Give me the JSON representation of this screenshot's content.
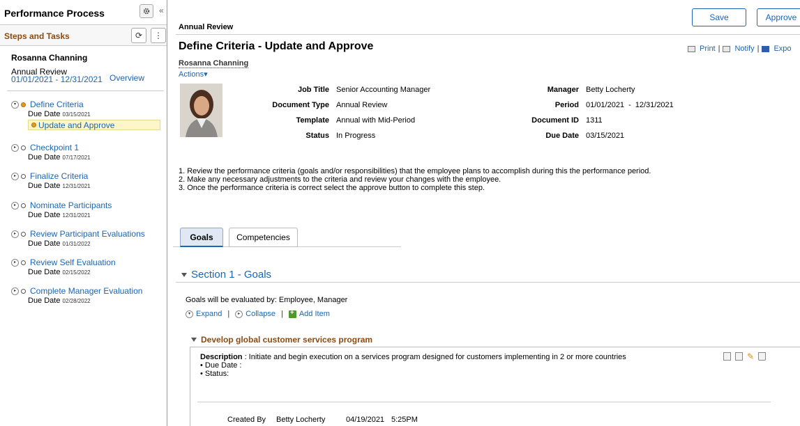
{
  "left": {
    "title": "Performance Process",
    "steps_header": "Steps and Tasks",
    "employee": "Rosanna Channing",
    "document_type": "Annual Review",
    "period_start": "01/01/2021",
    "period_sep": "-",
    "period_end": "12/31/2021",
    "overview": "Overview",
    "due_label": "Due Date",
    "steps": [
      {
        "label": "Define Criteria",
        "due": "03/15/2021",
        "status": "in-progress",
        "expanded": true,
        "subtask": "Update and Approve"
      },
      {
        "label": "Checkpoint 1",
        "due": "07/17/2021",
        "status": "not-started"
      },
      {
        "label": "Finalize Criteria",
        "due": "12/31/2021",
        "status": "not-started"
      },
      {
        "label": "Nominate Participants",
        "due": "12/31/2021",
        "status": "not-started"
      },
      {
        "label": "Review Participant Evaluations",
        "due": "01/31/2022",
        "status": "not-started"
      },
      {
        "label": "Review Self Evaluation",
        "due": "02/15/2022",
        "status": "not-started"
      },
      {
        "label": "Complete Manager Evaluation",
        "due": "02/28/2022",
        "status": "not-started"
      }
    ]
  },
  "toolbar": {
    "save": "Save",
    "approve": "Approve"
  },
  "main": {
    "breadcrumb": "Annual Review",
    "title": "Define Criteria - Update and Approve",
    "print": "Print",
    "notify": "Notify",
    "export": "Expo",
    "employee": "Rosanna Channing",
    "actions": "Actions",
    "details": {
      "job_title_label": "Job Title",
      "job_title": "Senior Accounting Manager",
      "doc_type_label": "Document Type",
      "doc_type": "Annual Review",
      "template_label": "Template",
      "template": "Annual with Mid-Period",
      "status_label": "Status",
      "status": "In Progress",
      "manager_label": "Manager",
      "manager": "Betty Locherty",
      "period_label": "Period",
      "period_start": "01/01/2021",
      "period_sep": "-",
      "period_end": "12/31/2021",
      "doc_id_label": "Document ID",
      "doc_id": "1311",
      "due_label": "Due Date",
      "due": "03/15/2021"
    },
    "instructions": [
      "1. Review the performance criteria (goals and/or responsibilities) that the employee plans to accomplish during this the performance period.",
      "2. Make any necessary adjustments to the criteria and review your changes with the employee.",
      "3. Once the performance criteria is correct select the approve button to complete this step."
    ],
    "tabs": [
      "Goals",
      "Competencies"
    ],
    "section_title": "Section 1 - Goals",
    "evaluated_by": "Goals will be evaluated by: Employee, Manager",
    "expand": "Expand",
    "collapse": "Collapse",
    "add_item": "Add Item",
    "item": {
      "title": "Develop global customer services program",
      "desc_label": "Description",
      "desc": " : Initiate and begin execution on a services program designed for customers implementing in 2 or more countries",
      "due_line": "• Due Date :",
      "status_line": "• Status:",
      "created_by_label": "Created By",
      "created_by": "Betty Locherty",
      "created_date": "04/19/2021",
      "created_time": "5:25PM"
    }
  },
  "colors": {
    "link": "#1a65b5",
    "section_brown": "#8a4b12",
    "highlight": "#fdf6c8",
    "in_progress": "#e39b1b"
  }
}
